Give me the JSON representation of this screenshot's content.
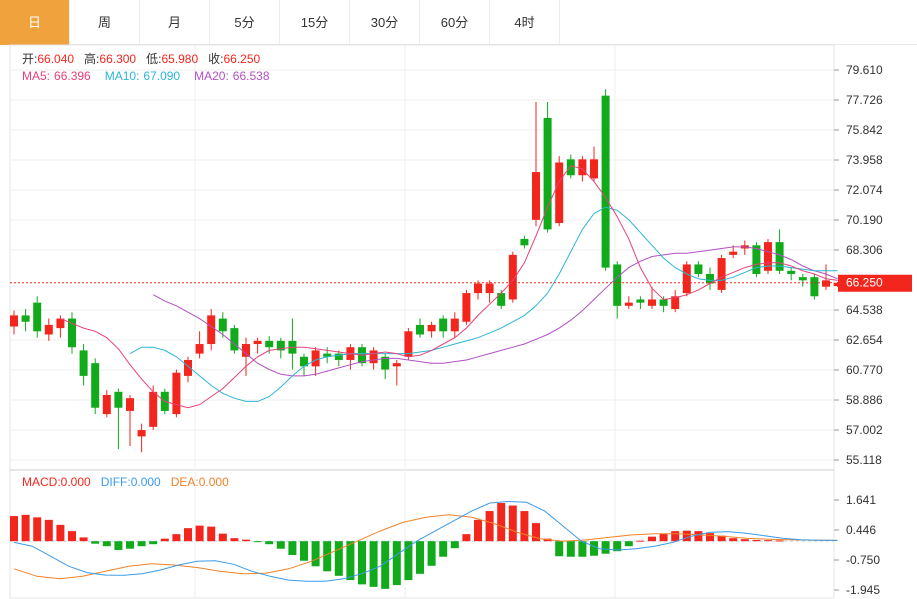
{
  "tabs": [
    {
      "label": "日",
      "active": true
    },
    {
      "label": "周"
    },
    {
      "label": "月"
    },
    {
      "label": "5分"
    },
    {
      "label": "15分"
    },
    {
      "label": "30分"
    },
    {
      "label": "60分"
    },
    {
      "label": "4时"
    }
  ],
  "ohlc_header": {
    "open_label": "开:",
    "open": "66.040",
    "high_label": "高:",
    "high": "66.300",
    "low_label": "低:",
    "low": "65.980",
    "close_label": "收:",
    "close": "66.250"
  },
  "ma_header": {
    "ma5_label": "MA5:",
    "ma5": "66.396",
    "ma10_label": "MA10:",
    "ma10": "67.090",
    "ma20_label": "MA20:",
    "ma20": "66.538"
  },
  "macd_header": {
    "macd_label": "MACD:",
    "macd": "0.000",
    "diff_label": "DIFF:",
    "diff": "0.000",
    "dea_label": "DEA:",
    "dea": "0.000"
  },
  "last_price_tag": "66.250",
  "colors": {
    "up": "#f2261d",
    "down": "#11aa1b",
    "ma5": "#e8407a",
    "ma10": "#2bb6d5",
    "ma20": "#b251c4",
    "diff": "#3a9bea",
    "dea": "#f08228",
    "active_tab": "#f0a23c"
  },
  "chart_data": [
    {
      "type": "candlestick",
      "y_ticks": [
        "79.610",
        "77.726",
        "75.842",
        "73.958",
        "72.074",
        "70.190",
        "68.306",
        "64.538",
        "62.654",
        "60.770",
        "58.886",
        "57.002",
        "55.118"
      ],
      "ylim": [
        55.118,
        79.61
      ],
      "last_price": 66.25,
      "candles": [
        [
          63.5,
          64.2,
          63.0,
          64.5
        ],
        [
          64.2,
          63.8,
          63.2,
          64.6
        ],
        [
          65.0,
          63.2,
          62.8,
          65.4
        ],
        [
          63.0,
          63.6,
          62.6,
          64.0
        ],
        [
          63.4,
          64.0,
          62.8,
          64.2
        ],
        [
          64.0,
          62.2,
          61.8,
          64.4
        ],
        [
          62.0,
          60.4,
          59.8,
          62.4
        ],
        [
          61.2,
          58.4,
          58.0,
          61.5
        ],
        [
          58.0,
          59.2,
          57.8,
          59.5
        ],
        [
          59.4,
          58.4,
          55.8,
          59.6
        ],
        [
          58.2,
          59.0,
          56.0,
          59.2
        ],
        [
          56.6,
          57.0,
          55.6,
          57.4
        ],
        [
          57.2,
          59.4,
          57.0,
          59.8
        ],
        [
          59.4,
          58.2,
          58.0,
          59.6
        ],
        [
          58.0,
          60.6,
          57.8,
          60.8
        ],
        [
          60.4,
          61.4,
          60.0,
          61.6
        ],
        [
          61.8,
          62.4,
          61.5,
          63.2
        ],
        [
          62.4,
          64.2,
          62.0,
          64.6
        ],
        [
          64.0,
          63.2,
          62.8,
          64.4
        ],
        [
          63.4,
          62.0,
          61.8,
          63.6
        ],
        [
          61.6,
          62.4,
          60.4,
          62.8
        ],
        [
          62.4,
          62.6,
          61.8,
          62.8
        ],
        [
          62.6,
          62.2,
          61.8,
          62.9
        ],
        [
          62.6,
          62.0,
          61.5,
          62.8
        ],
        [
          62.6,
          61.8,
          60.8,
          64.0
        ],
        [
          61.6,
          61.0,
          60.4,
          61.8
        ],
        [
          61.0,
          62.0,
          60.4,
          62.2
        ],
        [
          61.8,
          61.6,
          61.2,
          62.2
        ],
        [
          61.8,
          61.4,
          61.0,
          62.0
        ],
        [
          61.4,
          62.2,
          60.8,
          62.4
        ],
        [
          62.2,
          61.2,
          61.0,
          62.4
        ],
        [
          61.2,
          62.0,
          60.8,
          62.2
        ],
        [
          61.6,
          60.8,
          60.2,
          61.8
        ],
        [
          61.0,
          61.2,
          59.8,
          61.4
        ],
        [
          61.6,
          63.2,
          61.4,
          63.4
        ],
        [
          63.6,
          63.0,
          62.8,
          64.0
        ],
        [
          63.2,
          63.6,
          62.8,
          63.8
        ],
        [
          64.0,
          63.2,
          62.8,
          64.2
        ],
        [
          63.2,
          64.0,
          62.8,
          64.4
        ],
        [
          63.8,
          65.6,
          63.6,
          65.8
        ],
        [
          65.6,
          66.2,
          65.2,
          66.4
        ],
        [
          65.6,
          66.2,
          65.0,
          66.4
        ],
        [
          65.6,
          64.8,
          64.6,
          65.8
        ],
        [
          65.2,
          68.0,
          65.0,
          68.2
        ],
        [
          69.0,
          68.6,
          68.4,
          69.2
        ],
        [
          70.2,
          73.2,
          69.8,
          77.6
        ],
        [
          76.6,
          69.6,
          69.4,
          77.6
        ],
        [
          70.0,
          73.8,
          69.8,
          74.2
        ],
        [
          74.0,
          73.0,
          72.8,
          74.3
        ],
        [
          73.0,
          74.0,
          72.6,
          74.2
        ],
        [
          72.8,
          74.0,
          72.6,
          74.8
        ],
        [
          78.0,
          67.2,
          67.0,
          78.4
        ],
        [
          67.4,
          64.8,
          64.0,
          67.6
        ],
        [
          64.8,
          65.0,
          64.6,
          65.4
        ],
        [
          65.2,
          65.0,
          64.6,
          65.4
        ],
        [
          64.8,
          65.2,
          64.6,
          66.0
        ],
        [
          65.2,
          64.8,
          64.4,
          65.4
        ],
        [
          64.6,
          65.4,
          64.4,
          65.8
        ],
        [
          65.6,
          67.4,
          65.4,
          67.6
        ],
        [
          67.4,
          66.8,
          66.6,
          67.6
        ],
        [
          66.8,
          66.2,
          65.8,
          67.2
        ],
        [
          65.8,
          67.8,
          65.6,
          68.0
        ],
        [
          68.0,
          68.2,
          67.8,
          68.6
        ],
        [
          68.4,
          68.6,
          68.0,
          68.9
        ],
        [
          68.6,
          66.8,
          66.6,
          68.8
        ],
        [
          67.0,
          68.8,
          66.8,
          69.0
        ],
        [
          68.8,
          67.0,
          66.8,
          69.6
        ],
        [
          67.0,
          66.8,
          66.4,
          67.2
        ],
        [
          66.6,
          66.4,
          66.0,
          66.8
        ],
        [
          66.6,
          65.4,
          65.2,
          66.8
        ],
        [
          66.0,
          66.4,
          65.8,
          67.4
        ],
        [
          66.04,
          66.25,
          65.98,
          66.3
        ]
      ],
      "ma5": [
        64.0,
        63.7,
        63.4,
        63.2,
        62.8,
        62.1,
        61.1,
        60.2,
        59.4,
        58.8,
        58.6,
        58.4,
        58.6,
        59.1,
        59.6,
        60.3,
        61.0,
        61.6,
        62.0,
        62.1,
        62.2,
        62.2,
        62.1,
        62.0,
        61.9,
        61.8,
        61.7,
        61.8,
        61.9,
        61.8,
        61.6,
        61.7,
        62.0,
        62.4,
        62.8,
        63.4,
        64.2,
        64.9,
        65.6,
        66.4,
        67.5,
        69.2,
        71.0,
        72.6,
        73.6,
        73.4,
        72.6,
        71.6,
        70.4,
        69.0,
        67.2,
        65.9,
        65.2,
        65.3,
        65.5,
        65.8,
        66.2,
        66.6,
        66.9,
        67.2,
        67.4,
        67.5,
        67.5,
        67.3,
        67.0,
        66.8,
        66.5,
        66.4
      ],
      "ma10": [
        61.8,
        62.2,
        62.2,
        62.0,
        61.6,
        61.0,
        60.4,
        59.8,
        59.3,
        59.0,
        58.8,
        58.8,
        59.1,
        59.7,
        60.4,
        61.0,
        61.4,
        61.6,
        61.7,
        61.8,
        61.8,
        61.8,
        61.8,
        61.8,
        61.8,
        61.9,
        62.0,
        62.2,
        62.4,
        62.6,
        62.8,
        63.1,
        63.4,
        63.8,
        64.2,
        64.8,
        65.6,
        66.8,
        68.2,
        69.6,
        70.6,
        71.0,
        70.8,
        70.2,
        69.4,
        68.6,
        67.8,
        67.2,
        66.8,
        66.5,
        66.4,
        66.4,
        66.6,
        66.9,
        67.2,
        67.3,
        67.3,
        67.2,
        67.1,
        67.0,
        67.0,
        67.0
      ],
      "ma20": [
        65.5,
        65.1,
        64.8,
        64.4,
        64.0,
        63.5,
        63.0,
        62.4,
        61.8,
        61.2,
        60.8,
        60.5,
        60.4,
        60.4,
        60.5,
        60.7,
        60.9,
        61.1,
        61.3,
        61.4,
        61.5,
        61.5,
        61.4,
        61.3,
        61.2,
        61.2,
        61.3,
        61.4,
        61.6,
        61.8,
        62.0,
        62.2,
        62.4,
        62.7,
        63.0,
        63.4,
        63.9,
        64.5,
        65.2,
        65.9,
        66.6,
        67.2,
        67.6,
        67.9,
        68.0,
        68.1,
        68.1,
        68.2,
        68.3,
        68.4,
        68.5,
        68.5,
        68.4,
        68.2,
        68.0,
        67.7,
        67.3,
        67.0,
        66.8,
        66.5
      ]
    },
    {
      "type": "macd",
      "y_ticks": [
        "1.641",
        "0.446",
        "-0.750",
        "-1.945"
      ],
      "ylim": [
        -1.945,
        1.641
      ],
      "histogram": [
        1.0,
        1.05,
        0.95,
        0.85,
        0.65,
        0.4,
        0.15,
        -0.1,
        -0.2,
        -0.35,
        -0.3,
        -0.2,
        -0.12,
        0.1,
        0.28,
        0.52,
        0.62,
        0.58,
        0.3,
        0.12,
        0.06,
        -0.04,
        -0.12,
        -0.3,
        -0.55,
        -0.78,
        -1.0,
        -1.2,
        -1.38,
        -1.55,
        -1.72,
        -1.82,
        -1.9,
        -1.75,
        -1.55,
        -1.3,
        -0.98,
        -0.62,
        -0.28,
        0.28,
        0.85,
        1.2,
        1.52,
        1.42,
        1.2,
        0.72,
        0.1,
        -0.6,
        -0.62,
        -0.62,
        -0.58,
        -0.5,
        -0.4,
        -0.2,
        0.02,
        0.18,
        0.3,
        0.4,
        0.42,
        0.4,
        0.32,
        0.22,
        0.12,
        0.08,
        0.05,
        0.04,
        0.03
      ],
      "diff": [
        -0.05,
        -0.2,
        -0.6,
        -1.0,
        -1.25,
        -1.35,
        -1.36,
        -1.3,
        -1.15,
        -0.95,
        -0.8,
        -0.78,
        -0.92,
        -1.2,
        -1.4,
        -1.55,
        -1.6,
        -1.6,
        -1.5,
        -1.3,
        -1.0,
        -0.5,
        0.0,
        0.4,
        0.8,
        1.2,
        1.52,
        1.58,
        1.55,
        1.2,
        0.6,
        0.0,
        -0.3,
        -0.35,
        -0.3,
        -0.2,
        -0.05,
        0.2,
        0.35,
        0.38,
        0.32,
        0.22,
        0.12,
        0.06,
        0.04,
        0.03
      ],
      "dea": [
        -1.1,
        -1.4,
        -1.5,
        -1.4,
        -1.2,
        -1.0,
        -0.9,
        -0.95,
        -1.05,
        -1.2,
        -1.3,
        -1.28,
        -1.1,
        -0.8,
        -0.4,
        0.0,
        0.4,
        0.75,
        0.95,
        1.05,
        0.95,
        0.7,
        0.35,
        0.1,
        0.0,
        0.05,
        0.15,
        0.25,
        0.3,
        0.3,
        0.25,
        0.2,
        0.12,
        0.08,
        0.05,
        0.04,
        0.03
      ]
    }
  ]
}
